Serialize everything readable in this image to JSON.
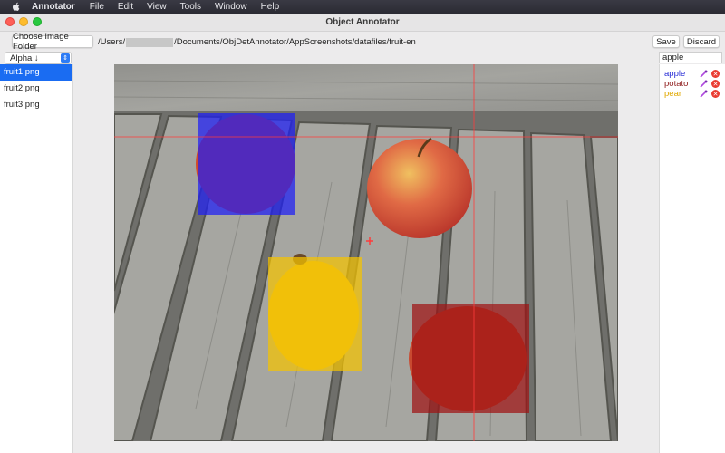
{
  "menubar": {
    "app_name": "Annotator",
    "items": [
      "File",
      "Edit",
      "View",
      "Tools",
      "Window",
      "Help"
    ]
  },
  "window": {
    "title": "Object Annotator"
  },
  "toolbar": {
    "choose_folder_label": "Choose Image Folder",
    "path_prefix": "/Users/",
    "path_suffix": "/Documents/ObjDetAnnotator/AppScreenshots/datafiles/fruit-en",
    "save_label": "Save",
    "discard_label": "Discard"
  },
  "sidebar": {
    "sort_label": "Alpha ↓",
    "files": [
      "fruit1.png",
      "fruit2.png",
      "fruit3.png"
    ],
    "selected_index": 0
  },
  "labels_panel": {
    "input_value": "apple",
    "labels": [
      {
        "name": "apple",
        "color": "#2a2fd6"
      },
      {
        "name": "potato",
        "color": "#8f1d1d"
      },
      {
        "name": "pear",
        "color": "#e0a800"
      }
    ]
  },
  "annotations": [
    {
      "label": "apple",
      "color": "#1e1ef5"
    },
    {
      "label": "pear",
      "color": "#f5c400"
    },
    {
      "label": "potato",
      "color": "#a01414"
    }
  ]
}
